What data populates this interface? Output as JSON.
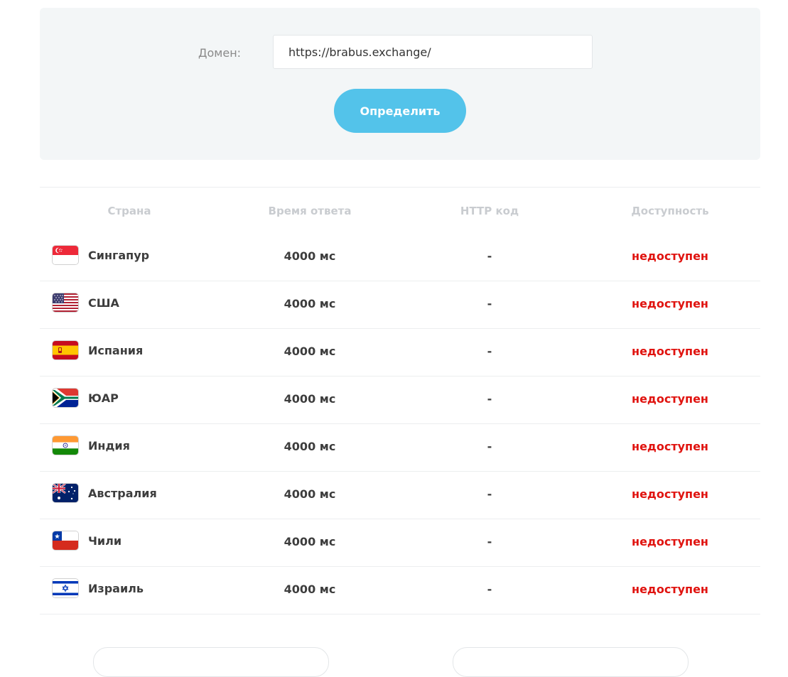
{
  "form": {
    "domain_label": "Домен:",
    "domain_value": "https://brabus.exchange/",
    "submit_label": "Определить"
  },
  "table": {
    "headers": [
      "Страна",
      "Время ответа",
      "HTTP код",
      "Доступность"
    ],
    "rows": [
      {
        "flag": "singapore-flag-icon",
        "country": "Сингапур",
        "time": "4000 мс",
        "code": "-",
        "status": "недоступен"
      },
      {
        "flag": "usa-flag-icon",
        "country": "США",
        "time": "4000 мс",
        "code": "-",
        "status": "недоступен"
      },
      {
        "flag": "spain-flag-icon",
        "country": "Испания",
        "time": "4000 мс",
        "code": "-",
        "status": "недоступен"
      },
      {
        "flag": "south-africa-flag-icon",
        "country": "ЮАР",
        "time": "4000 мс",
        "code": "-",
        "status": "недоступен"
      },
      {
        "flag": "india-flag-icon",
        "country": "Индия",
        "time": "4000 мс",
        "code": "-",
        "status": "недоступен"
      },
      {
        "flag": "australia-flag-icon",
        "country": "Австралия",
        "time": "4000 мс",
        "code": "-",
        "status": "недоступен"
      },
      {
        "flag": "chile-flag-icon",
        "country": "Чили",
        "time": "4000 мс",
        "code": "-",
        "status": "недоступен"
      },
      {
        "flag": "israel-flag-icon",
        "country": "Израиль",
        "time": "4000 мс",
        "code": "-",
        "status": "недоступен"
      }
    ]
  },
  "colors": {
    "accent": "#53c3ea",
    "unavailable": "#e0130f",
    "panel_bg": "#f3f6f7"
  }
}
